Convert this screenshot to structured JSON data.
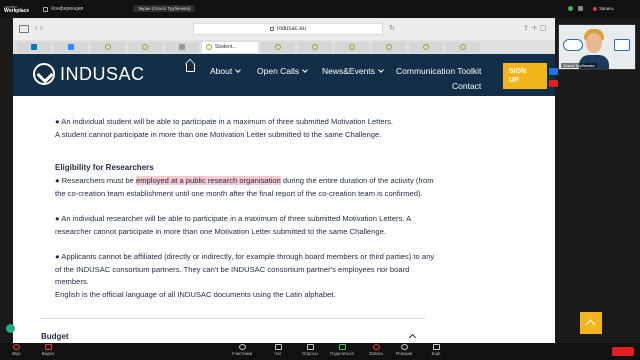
{
  "app": {
    "brand_top": "yandex",
    "brand": "Workplace",
    "conference_label": "Конференция",
    "screen_tag": "Экран (Ольга Трубачева)",
    "recording_label": "Запись"
  },
  "browser": {
    "url": "indusac.eu",
    "active_tab_label": "Student..."
  },
  "site": {
    "logo_text": "INDUSAC",
    "menu": {
      "about": "About",
      "open_calls": "Open Calls",
      "news_events": "News&Events",
      "toolkit": "Communication Toolkit",
      "signup_line1": "SIGN",
      "signup_line2": "UP",
      "contact": "Contact"
    }
  },
  "content": {
    "line_top1": "● An individual student will be able to participate in a maximum of three submitted Motivation Letters.",
    "line_top2": "A student cannot participate in more than one Motivation Letter submitted to the same Challenge.",
    "eligibility_title": "Eligibility for Researchers",
    "p1_before": "● Researchers must be ",
    "p1_highlight": "employed at a public research organisation",
    "p1_after": " during the entire duration of the activity (from the co-creation team establishment until one month after the final report of the co-creation team is confirmed).",
    "p2": "● An individual researcher will be able to participate in a maximum of three submitted Motivation Letters. A researcher cannot participate in more than one Motivation Letter submitted to the same Challenge.",
    "p3": "● Applicants cannot be affiliated (directly or indirectly, for example through board members or third parties) to any of the INDUSAC consortium partners. They can't be INDUSAC consortium partner's employees nor board members.",
    "p4": "English is the official language of all INDUSAC documents using the Latin alphabet.",
    "budget_label": "Budget"
  },
  "video": {
    "participant_name": "Ольга Трубачева"
  },
  "toolbar": {
    "mic": "Звук",
    "camera": "Видео",
    "participants": "Участники",
    "chat": "Чат",
    "polls": "Опросы",
    "share": "Поделиться",
    "recording": "Запись",
    "reactions": "Реакции",
    "more": "Ещё"
  },
  "colors": {
    "header_bg": "#132f48",
    "accent": "#f3b51c",
    "highlight": "#f6c9cf"
  }
}
